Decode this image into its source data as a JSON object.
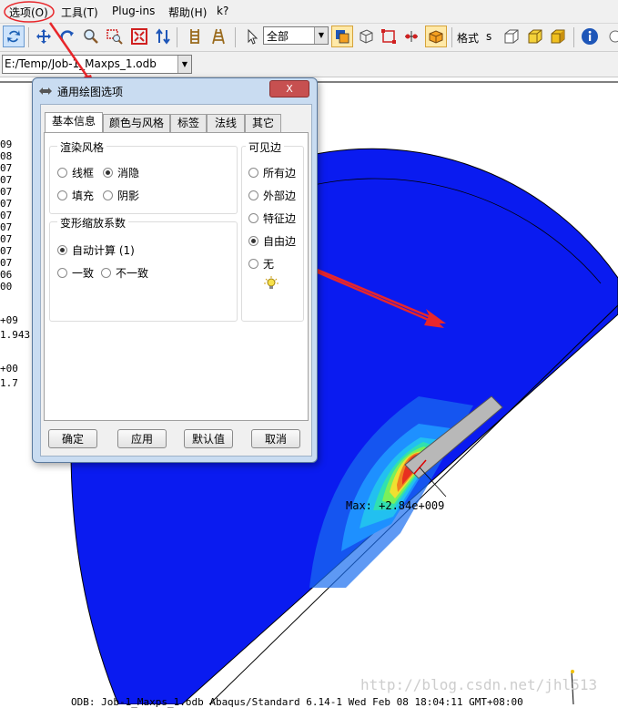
{
  "menubar": {
    "items": [
      "选项(O)",
      "工具(T)",
      "Plug-ins",
      "帮助(H)",
      "k?"
    ]
  },
  "toolbar": {
    "combo_render": "全部",
    "format_label": "格式",
    "format_value": "s"
  },
  "pathbar": {
    "odb_path": "E:/Temp/Job-1_Maxps_1.odb"
  },
  "legend": {
    "values": [
      "09",
      "08",
      "07",
      "07",
      "07",
      "07",
      "07",
      "07",
      "07",
      "07",
      "07",
      "06",
      "00"
    ],
    "header1": "+09",
    "header1_value": "1.943",
    "header2": "+00",
    "header2_value": "1.7"
  },
  "dialog": {
    "title": "通用绘图选项",
    "close_label": "X",
    "tabs": [
      "基本信息",
      "颜色与风格",
      "标签",
      "法线",
      "其它"
    ],
    "render_style": {
      "title": "渲染风格",
      "options": [
        "线框",
        "消隐",
        "填充",
        "阴影"
      ],
      "selected": "消隐"
    },
    "deform_scale": {
      "title": "变形缩放系数",
      "auto_label": "自动计算 (1)",
      "uniform_label": "一致",
      "nonuniform_label": "不一致",
      "selected": "自动计算 (1)"
    },
    "visible_edges": {
      "title": "可见边",
      "options": [
        "所有边",
        "外部边",
        "特征边",
        "自由边",
        "无"
      ],
      "selected": "自由边"
    },
    "buttons": {
      "ok": "确定",
      "apply": "应用",
      "defaults": "默认值",
      "cancel": "取消"
    }
  },
  "viewport": {
    "max_label": "Max: +2.84e+009",
    "status_text": "ODB: Job-1_Maxps_1.odb    Abaqus/Standard 6.14-1    Wed Feb 08 18:04:11 GMT+08:00",
    "watermark": "http://blog.csdn.net/jhl513"
  },
  "colors": {
    "model_blue": "#0a1bf0",
    "annotation_red": "#e8262a"
  }
}
